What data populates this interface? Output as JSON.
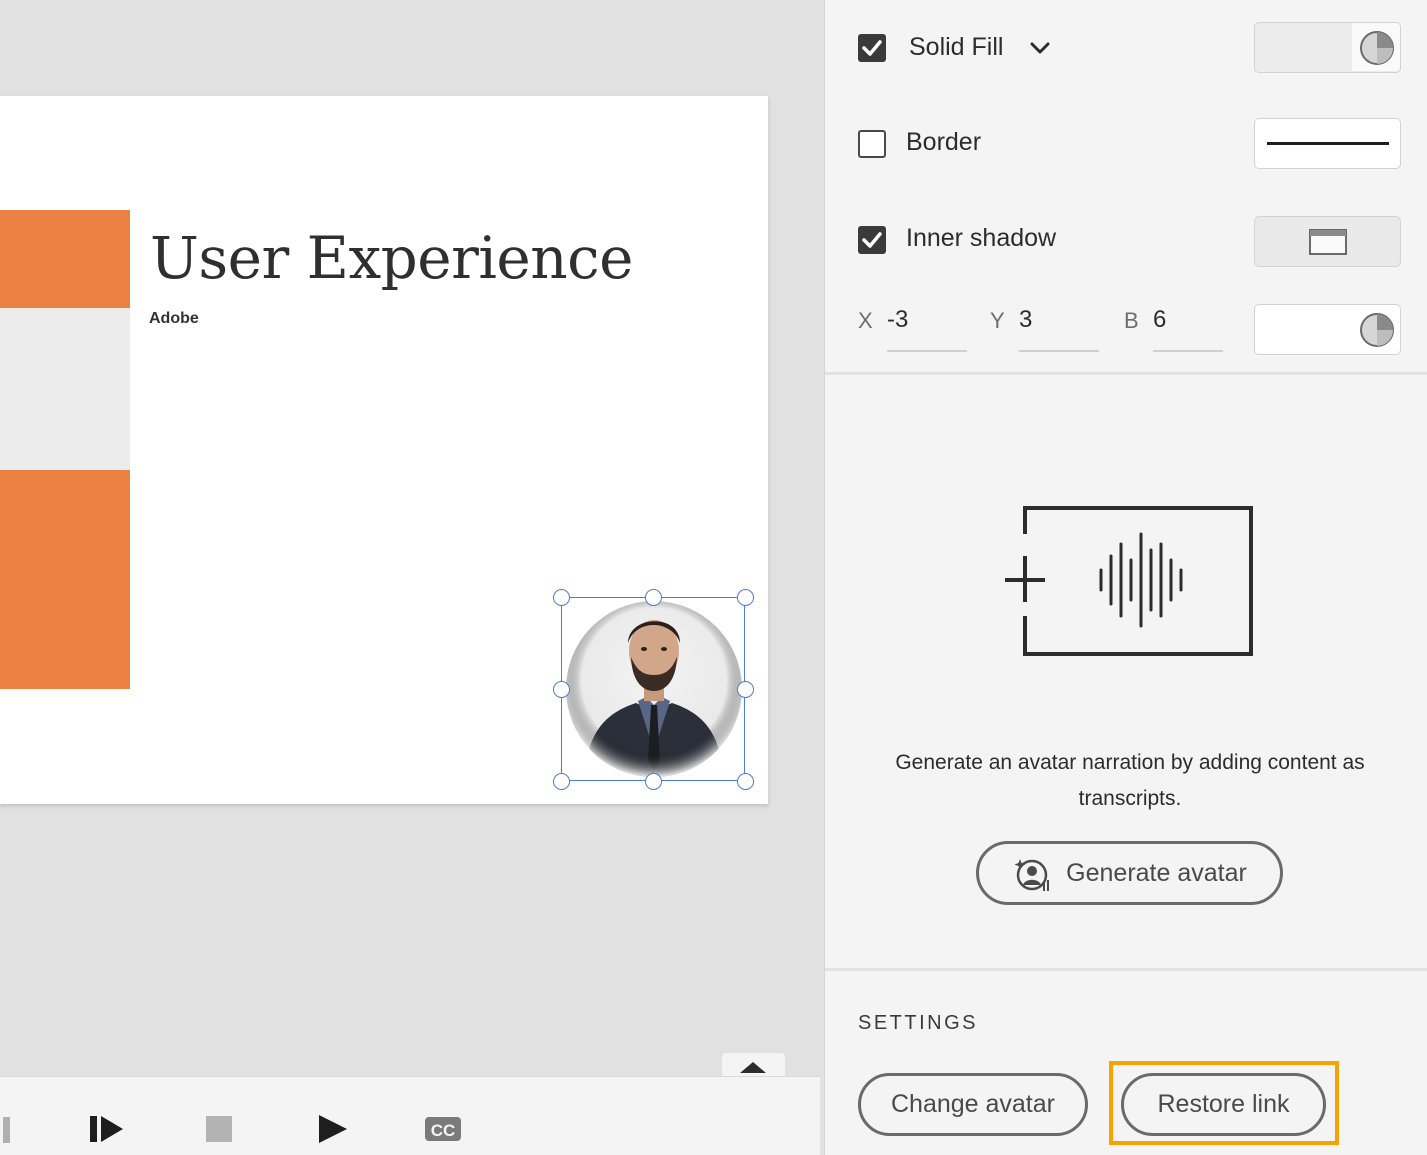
{
  "slide": {
    "title": "User Experience",
    "subtitle": "Adobe",
    "accent_color": "#eb8142"
  },
  "panel": {
    "solid_fill": {
      "label": "Solid Fill",
      "checked": true
    },
    "border": {
      "label": "Border",
      "checked": false
    },
    "inner_shadow": {
      "label": "Inner shadow",
      "checked": true
    },
    "shadow": {
      "x_label": "X",
      "x_value": "-3",
      "y_label": "Y",
      "y_value": "3",
      "b_label": "B",
      "b_value": "6"
    },
    "avatar_section": {
      "helper_text": "Generate an avatar narration by adding content as transcripts.",
      "generate_button": "Generate avatar"
    },
    "settings": {
      "title": "SETTINGS",
      "change_avatar_button": "Change avatar",
      "restore_link_button": "Restore link"
    },
    "highlight_color": "#f5a300"
  },
  "playback": {
    "cc_label": "CC"
  }
}
